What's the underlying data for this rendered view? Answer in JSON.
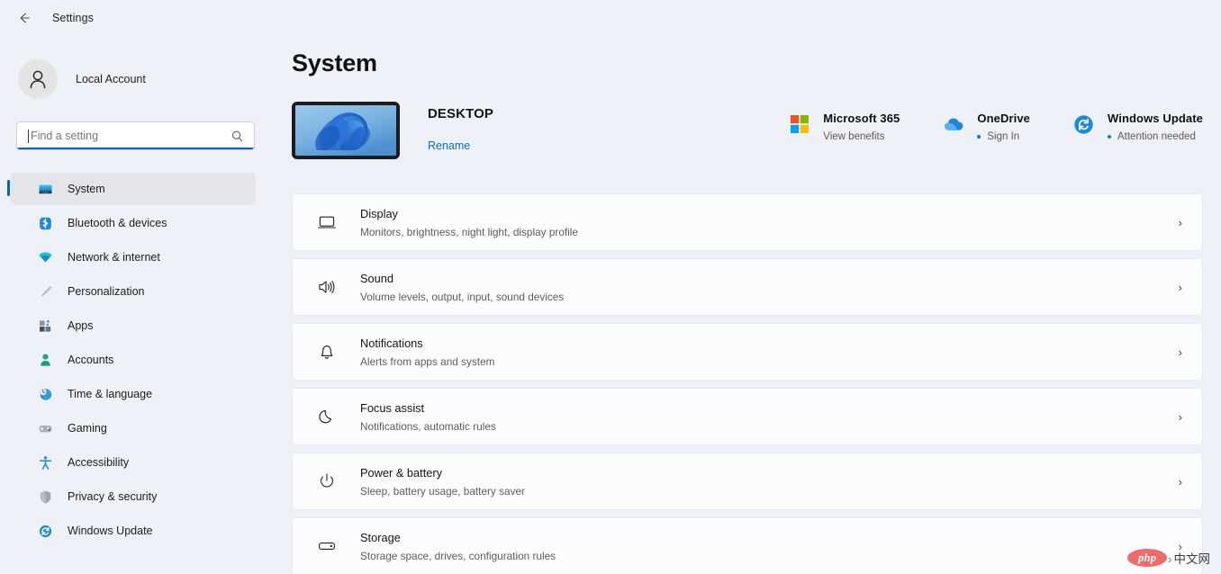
{
  "titlebar": {
    "back_icon": "back-arrow-icon",
    "title": "Settings"
  },
  "sidebar": {
    "account": {
      "avatar_icon": "user-avatar-icon",
      "name": "Local Account"
    },
    "search": {
      "placeholder": "Find a setting",
      "value": "",
      "icon": "search-icon",
      "focused": true,
      "accent_color": "#0067c0"
    },
    "items": [
      {
        "label": "System",
        "icon": "monitor-icon",
        "selected": true
      },
      {
        "label": "Bluetooth & devices",
        "icon": "bluetooth-icon",
        "selected": false
      },
      {
        "label": "Network & internet",
        "icon": "wifi-icon",
        "selected": false
      },
      {
        "label": "Personalization",
        "icon": "paintbrush-icon",
        "selected": false
      },
      {
        "label": "Apps",
        "icon": "apps-grid-icon",
        "selected": false
      },
      {
        "label": "Accounts",
        "icon": "person-icon",
        "selected": false
      },
      {
        "label": "Time & language",
        "icon": "clock-globe-icon",
        "selected": false
      },
      {
        "label": "Gaming",
        "icon": "gamepad-icon",
        "selected": false
      },
      {
        "label": "Accessibility",
        "icon": "accessibility-icon",
        "selected": false
      },
      {
        "label": "Privacy & security",
        "icon": "shield-icon",
        "selected": false
      },
      {
        "label": "Windows Update",
        "icon": "update-refresh-icon",
        "selected": false
      }
    ]
  },
  "main": {
    "page_title": "System",
    "device": {
      "thumbnail_icon": "windows-bloom-wallpaper-thumbnail",
      "name": "DESKTOP",
      "rename_label": "Rename",
      "rename_color": "#0d6bc4"
    },
    "status_cards": [
      {
        "icon": "microsoft-logo-icon",
        "title": "Microsoft 365",
        "sub": "View benefits",
        "has_dot": false
      },
      {
        "icon": "onedrive-cloud-icon",
        "title": "OneDrive",
        "sub": "Sign In",
        "has_dot": true
      },
      {
        "icon": "windows-update-icon",
        "title": "Windows Update",
        "sub": "Attention needed",
        "has_dot": true
      }
    ],
    "settings_rows": [
      {
        "icon": "display-monitor-icon",
        "title": "Display",
        "sub": "Monitors, brightness, night light, display profile",
        "chevron": "›"
      },
      {
        "icon": "sound-speaker-icon",
        "title": "Sound",
        "sub": "Volume levels, output, input, sound devices",
        "chevron": "›"
      },
      {
        "icon": "notifications-bell-icon",
        "title": "Notifications",
        "sub": "Alerts from apps and system",
        "chevron": "›"
      },
      {
        "icon": "focus-assist-moon-icon",
        "title": "Focus assist",
        "sub": "Notifications, automatic rules",
        "chevron": "›"
      },
      {
        "icon": "power-battery-icon",
        "title": "Power & battery",
        "sub": "Sleep, battery usage, battery saver",
        "chevron": "›"
      },
      {
        "icon": "storage-drive-icon",
        "title": "Storage",
        "sub": "Storage space, drives, configuration rules",
        "chevron": "›"
      }
    ]
  },
  "watermark": {
    "logo_text": "php",
    "caret": "›",
    "text": "中文网"
  }
}
